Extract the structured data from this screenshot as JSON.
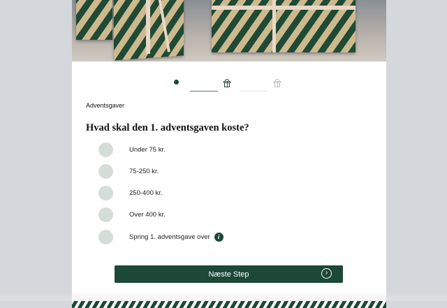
{
  "progress": {
    "steps": [
      {
        "icon": "dot",
        "state": "current"
      },
      {
        "icon": "gift-icon",
        "state": "active"
      },
      {
        "icon": "gift-icon",
        "state": "inactive"
      }
    ]
  },
  "section_label": "Adventsgaver",
  "question": "Hvad skal den 1. adventsgaven koste?",
  "options": [
    {
      "label": "Under 75 kr."
    },
    {
      "label": "75-250 kr."
    },
    {
      "label": "250-400 kr."
    },
    {
      "label": "Over 400 kr."
    },
    {
      "label": "Spring 1. adventsgave over",
      "info_icon": "i"
    }
  ],
  "next_button": {
    "label": "Næste Step",
    "icon": "chevron-right-circle-icon"
  },
  "colors": {
    "accent": "#1c4836",
    "radio": "#d5ddd9",
    "background": "#d4d7db"
  }
}
